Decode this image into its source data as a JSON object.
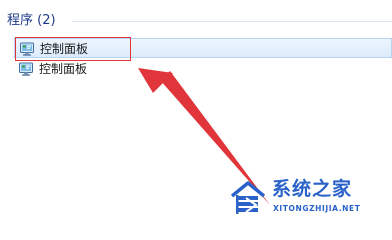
{
  "results": {
    "section_title": "程序 (2)",
    "items": [
      {
        "label": "控制面板",
        "icon": "control-panel-icon",
        "selected": true
      },
      {
        "label": "控制面板",
        "icon": "control-panel-icon",
        "selected": false
      }
    ]
  },
  "annotation": {
    "highlight_color": "#e0353b",
    "arrow_color": "#e0353b"
  },
  "watermark": {
    "title": "系统之家",
    "url": "XITONGZHIJIA.NET",
    "color": "#2a62c9"
  }
}
